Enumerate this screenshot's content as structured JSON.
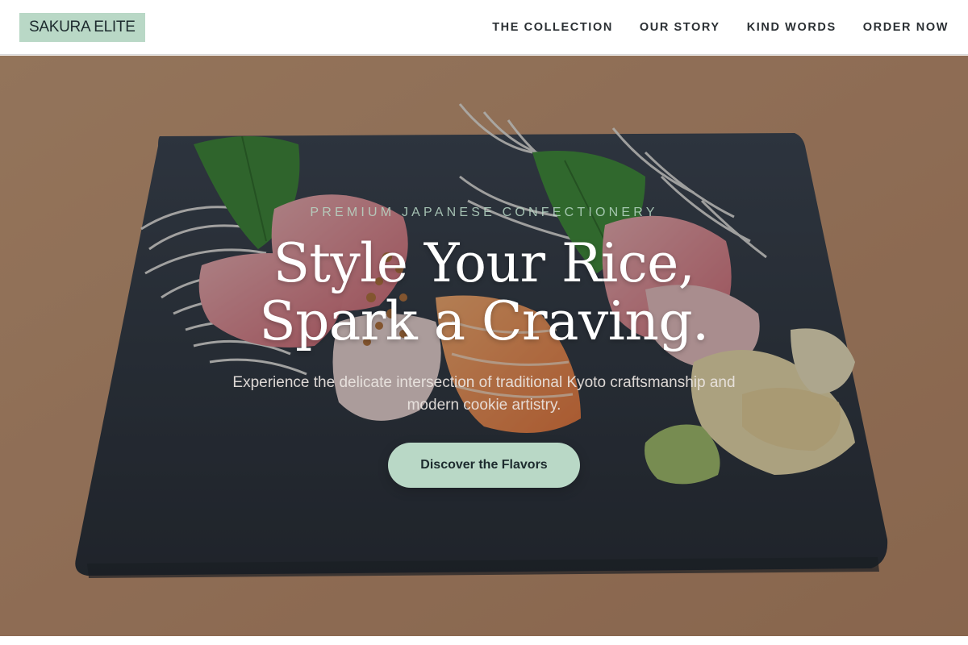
{
  "header": {
    "brand": "SAKURA ELITE",
    "nav": [
      {
        "label": "THE COLLECTION"
      },
      {
        "label": "OUR STORY"
      },
      {
        "label": "KIND WORDS"
      },
      {
        "label": "ORDER NOW"
      }
    ]
  },
  "hero": {
    "eyebrow": "PREMIUM JAPANESE CONFECTIONERY",
    "headline_line1": "Style Your Rice,",
    "headline_line2": "Spark a Craving.",
    "subtext": "Experience the delicate intersection of traditional Kyoto craftsmanship and modern cookie artistry.",
    "cta_label": "Discover the Flavors"
  },
  "theme": {
    "accent": "#b9d8c6",
    "text_dark": "#1d2b2e",
    "table_wood": "#c9966d",
    "slate": "#2d333d"
  }
}
